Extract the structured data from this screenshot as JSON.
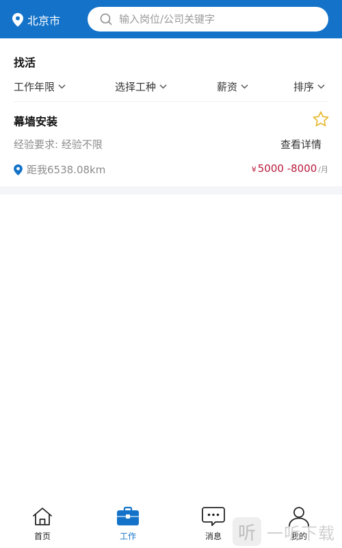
{
  "header": {
    "city": "北京市",
    "search_placeholder": "输入岗位/公司关键字",
    "search_value": ""
  },
  "section_title": "找活",
  "filters": [
    {
      "label": "工作年限"
    },
    {
      "label": "选择工种"
    },
    {
      "label": "薪资"
    },
    {
      "label": "排序"
    }
  ],
  "jobs": [
    {
      "title": "幕墙安装",
      "experience": "经验要求:  经验不限",
      "detail_label": "查看详情",
      "distance": "距我6538.08km",
      "salary_currency": "¥",
      "salary_range": "5000 -8000",
      "salary_unit": "/月"
    }
  ],
  "tabbar": [
    {
      "label": "首页",
      "icon": "home-icon"
    },
    {
      "label": "工作",
      "icon": "briefcase-icon",
      "active": true
    },
    {
      "label": "消息",
      "icon": "message-icon"
    },
    {
      "label": "我的",
      "icon": "user-icon"
    }
  ],
  "watermark": {
    "glyph": "听",
    "text": "一听下载"
  },
  "colors": {
    "brand": "#1473c9",
    "salary": "#b8193a",
    "star": "#e8b931"
  }
}
